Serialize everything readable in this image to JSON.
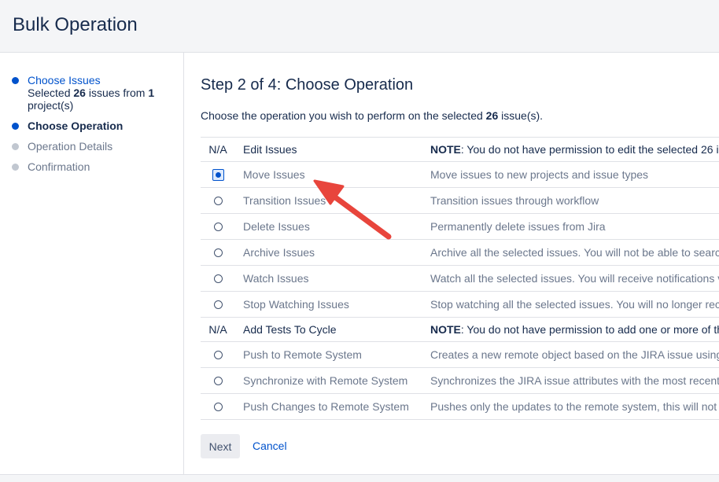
{
  "header": {
    "title": "Bulk Operation"
  },
  "steps": [
    {
      "label": "Choose Issues",
      "state": "done",
      "sub": {
        "pre": "Selected ",
        "count": "26",
        "mid": " issues from ",
        "projects": "1",
        "post": " project(s)"
      }
    },
    {
      "label": "Choose Operation",
      "state": "active"
    },
    {
      "label": "Operation Details",
      "state": "future"
    },
    {
      "label": "Confirmation",
      "state": "future"
    }
  ],
  "main": {
    "title": "Step 2 of 4: Choose Operation",
    "intro": {
      "pre": "Choose the operation you wish to perform on the selected ",
      "count": "26",
      "post": " issue(s)."
    }
  },
  "operations": [
    {
      "na": "N/A",
      "name": "Edit Issues",
      "note_label": "NOTE",
      "desc": ": You do not have permission to edit the selected 26 i"
    },
    {
      "name": "Move Issues",
      "desc": "Move issues to new projects and issue types",
      "selected": true
    },
    {
      "name": "Transition Issues",
      "desc": "Transition issues through workflow"
    },
    {
      "name": "Delete Issues",
      "desc": "Permanently delete issues from Jira"
    },
    {
      "name": "Archive Issues",
      "desc": "Archive all the selected issues. You will not be able to searc"
    },
    {
      "name": "Watch Issues",
      "desc": "Watch all the selected issues. You will receive notifications v"
    },
    {
      "name": "Stop Watching Issues",
      "desc": "Stop watching all the selected issues. You will no longer rec"
    },
    {
      "na": "N/A",
      "name": "Add Tests To Cycle",
      "note_label": "NOTE",
      "desc": ": You do not have permission to add one or more of th"
    },
    {
      "name": "Push to Remote System",
      "desc": "Creates a new remote object based on the JIRA issue using"
    },
    {
      "name": "Synchronize with Remote System",
      "desc": "Synchronizes the JIRA issue attributes with the most recent"
    },
    {
      "name": "Push Changes to Remote System",
      "desc": "Pushes only the updates to the remote system, this will not"
    }
  ],
  "actions": {
    "next": "Next",
    "cancel": "Cancel"
  },
  "colors": {
    "accent": "#0052cc",
    "arrow": "#e8453c"
  }
}
